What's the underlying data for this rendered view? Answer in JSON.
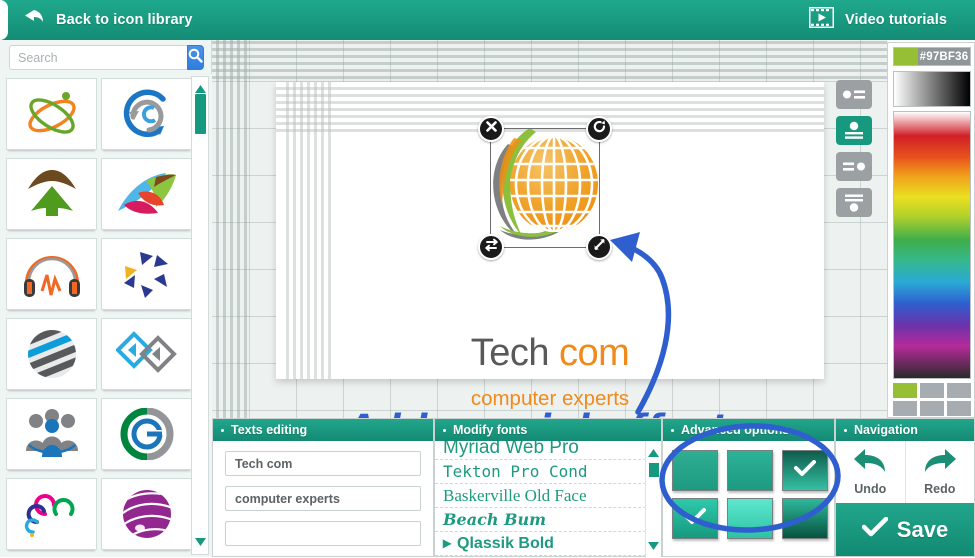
{
  "topbar": {
    "back_label": "Back to icon library",
    "back_icon": "back-arrow-icon",
    "video_label": "Video tutorials",
    "video_icon": "film-play-icon",
    "bg_color": "#159a80"
  },
  "library": {
    "search": {
      "placeholder": "Search",
      "value": "",
      "button_icon": "search-icon"
    },
    "scrollbar": {
      "up_icon": "triangle-up-icon",
      "down_icon": "triangle-down-icon"
    },
    "icons": [
      {
        "name": "atom-orbit-logo",
        "colors": [
          "#f58220",
          "#6aa52b"
        ]
      },
      {
        "name": "blue-circle-arrow-logo",
        "colors": [
          "#1b77c4",
          "#9a9a9a"
        ]
      },
      {
        "name": "brown-green-arrow-house-logo",
        "colors": [
          "#6b4a20",
          "#4f9b1e"
        ]
      },
      {
        "name": "colorful-swoosh-logo",
        "colors": [
          "#4fb6e8",
          "#8cc63f",
          "#e8432b",
          "#d81b60",
          "#7b4a20"
        ]
      },
      {
        "name": "headphones-waveform-logo",
        "colors": [
          "#f26722",
          "#3a3a3a"
        ]
      },
      {
        "name": "blue-triangle-star-logo",
        "colors": [
          "#2b3990",
          "#f0b323"
        ]
      },
      {
        "name": "striped-gray-blue-sphere-logo",
        "colors": [
          "#0d9ddb",
          "#58595b"
        ]
      },
      {
        "name": "blue-gray-diamond-arrows-logo",
        "colors": [
          "#29abe2",
          "#808285"
        ]
      },
      {
        "name": "gray-blue-people-group-logo",
        "colors": [
          "#808285",
          "#1b75bb"
        ]
      },
      {
        "name": "green-gray-e-circle-logo",
        "colors": [
          "#00853f",
          "#1b75bb",
          "#939598"
        ]
      },
      {
        "name": "multicolor-swirl-cloud-logo",
        "colors": [
          "#ec008c",
          "#00a651",
          "#2e3192",
          "#27aae1"
        ]
      },
      {
        "name": "purple-striped-sphere-logo",
        "colors": [
          "#92278f"
        ]
      }
    ]
  },
  "workspace": {
    "selection": {
      "handles": [
        {
          "name": "delete-handle",
          "icon": "close-icon"
        },
        {
          "name": "rotate-handle",
          "icon": "rotate-icon"
        },
        {
          "name": "flip-handle",
          "icon": "flip-horizontal-icon"
        },
        {
          "name": "resize-handle",
          "icon": "resize-diagonal-icon"
        }
      ]
    },
    "logo": {
      "art_name": "orange-globe-green-swoosh-logo",
      "title_part1": "Tech ",
      "title_part2": "com",
      "title_color1": "#595959",
      "title_color2": "#f08a1c",
      "subtitle": "computer experts",
      "subtitle_color": "#f08a1c"
    },
    "annotation": {
      "text": "Add special effects",
      "color": "#2f5fcf",
      "arrow_icon": "curved-arrow-icon"
    }
  },
  "align_tools": {
    "buttons": [
      {
        "name": "align-icon-left",
        "active": false
      },
      {
        "name": "align-icon-top",
        "active": true
      },
      {
        "name": "align-icon-right",
        "active": false
      },
      {
        "name": "align-icon-bottom",
        "active": false
      }
    ]
  },
  "color_picker": {
    "hex": "#97BF36",
    "swatch_color": "#97BF36",
    "recent_colors": [
      "#97BF36",
      "#a6acaf",
      "#a6acaf",
      "#a6acaf",
      "#a6acaf",
      "#a6acaf"
    ]
  },
  "panels": {
    "texts_editing": {
      "title": "Texts editing",
      "fields": [
        {
          "name": "text-field-1",
          "value": "Tech com"
        },
        {
          "name": "text-field-2",
          "value": "computer experts"
        },
        {
          "name": "text-field-3",
          "value": ""
        }
      ]
    },
    "modify_fonts": {
      "title": "Modify fonts",
      "items": [
        "Myriad Web Pro",
        "Tekton Pro Cond",
        "Baskerville Old Face",
        "Beach Bum",
        "Qlassik Bold"
      ],
      "selected_index": 4,
      "selected_marker": "▸"
    },
    "advanced_options": {
      "title": "Advanced options",
      "swatches": [
        {
          "name": "effect-swatch-1",
          "checked": false,
          "gradient": [
            "#2fae94",
            "#1e9a80"
          ]
        },
        {
          "name": "effect-swatch-2",
          "checked": false,
          "gradient": [
            "#2cb398",
            "#1d9a80"
          ]
        },
        {
          "name": "effect-swatch-3",
          "checked": true,
          "gradient": [
            "#0f5c4c",
            "#35c0a4"
          ]
        },
        {
          "name": "effect-swatch-4",
          "checked": true,
          "gradient": [
            "#2fc9ab",
            "#16997f"
          ]
        },
        {
          "name": "effect-swatch-5",
          "checked": false,
          "gradient": [
            "#5ee8cd",
            "#2ec2a4"
          ]
        },
        {
          "name": "effect-swatch-6",
          "checked": false,
          "gradient": [
            "#2fb89c",
            "#08523f"
          ]
        }
      ],
      "check_icon": "check-icon"
    },
    "navigation": {
      "title": "Navigation",
      "undo_label": "Undo",
      "undo_icon": "undo-arrow-icon",
      "redo_label": "Redo",
      "redo_icon": "redo-arrow-icon",
      "save_label": "Save",
      "save_icon": "check-icon"
    }
  }
}
